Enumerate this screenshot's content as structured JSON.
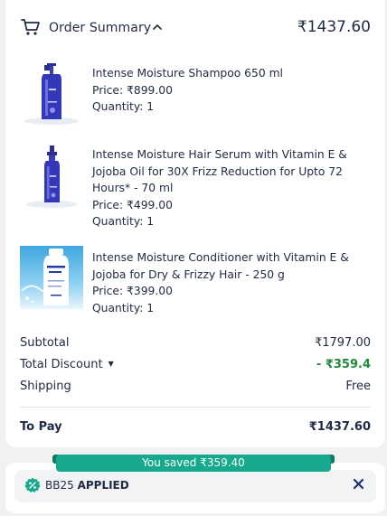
{
  "header": {
    "title": "Order Summary",
    "total": "₹1437.60"
  },
  "items": [
    {
      "name": "Intense Moisture Shampoo 650 ml",
      "price": "Price: ₹899.00",
      "quantity": "Quantity: 1",
      "image": "shampoo-bottle"
    },
    {
      "name": "Intense Moisture Hair Serum with Vitamin E & Jojoba Oil for 30X Frizz Reduction for Upto 72 Hours* - 70 ml",
      "price": "Price: ₹499.00",
      "quantity": "Quantity: 1",
      "image": "serum-bottle"
    },
    {
      "name": "Intense Moisture Conditioner with Vitamin E & Jojoba for Dry & Frizzy Hair - 250 g",
      "price": "Price: ₹399.00",
      "quantity": "Quantity: 1",
      "image": "conditioner-bottle"
    }
  ],
  "summary": {
    "subtotal_label": "Subtotal",
    "subtotal_value": "₹1797.00",
    "discount_label": "Total Discount",
    "discount_value": "- ₹359.4",
    "shipping_label": "Shipping",
    "shipping_value": "Free",
    "to_pay_label": "To Pay",
    "to_pay_value": "₹1437.60"
  },
  "savings": {
    "text": "You saved ₹359.40"
  },
  "coupon": {
    "code": "BB25",
    "status": "APPLIED"
  },
  "colors": {
    "accent_green": "#17a98d",
    "discount_green": "#1e8a3c",
    "text": "#1f2a44"
  },
  "icons": [
    "cart-icon",
    "chevron-up-icon",
    "caret-down-icon",
    "coupon-badge-icon",
    "close-icon"
  ]
}
